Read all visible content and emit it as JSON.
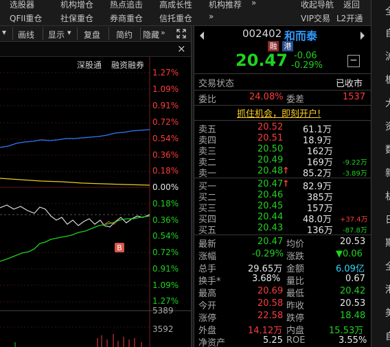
{
  "top_menu": {
    "row1": [
      "选股器",
      "机构增仓",
      "热点追击",
      "高成长性",
      "机构推荐",
      "收起导航",
      "返回"
    ],
    "row2": [
      "QFII重仓",
      "社保重仓",
      "券商重仓",
      "信托重仓",
      "VIP交易",
      "L2开通"
    ],
    "more": "»"
  },
  "right_strip": [
    "全",
    "自",
    "沪",
    "板",
    "大",
    "资",
    "数",
    "新",
    "机",
    "日",
    "期",
    "全",
    "港",
    "美",
    "自"
  ],
  "chart_toolbar": {
    "items": [
      "画线",
      "显示",
      "复盘",
      "简约",
      "隐藏"
    ],
    "dropdown": "▾",
    "close": "×",
    "legend": [
      "深股通",
      "融资融券"
    ]
  },
  "axis_labels": {
    "top": [
      "1.27%",
      "1.09%",
      "0.91%",
      "0.72%",
      "0.54%",
      "0.36%",
      "0.18%",
      "0.00%",
      "0.18%",
      "0.36%",
      "0.54%",
      "0.72%",
      "0.91%",
      "1.09%",
      "1.27%"
    ],
    "volume": [
      "5389",
      "3592"
    ],
    "marker": "B"
  },
  "quote": {
    "code": "002402",
    "name": "和而泰",
    "badge1": "融",
    "badge2": "港",
    "price": "20.47",
    "change": "-0.06",
    "change_pct": "-0.29%",
    "minus_btn": "−",
    "status_label": "交易状态",
    "status_value": "已收市",
    "weibi_label": "委比",
    "weibi_value": "24.08%",
    "weicha_label": "委差",
    "weicha_value": "1537",
    "promo": "抓住机会，即刻开户!",
    "asks": [
      {
        "label": "卖五",
        "price": "20.52",
        "vol": "61.1万",
        "chg": "",
        "arrow": ""
      },
      {
        "label": "卖四",
        "price": "20.51",
        "vol": "18.9万",
        "chg": "",
        "arrow": ""
      },
      {
        "label": "卖三",
        "price": "20.50",
        "vol": "162万",
        "chg": "",
        "arrow": ""
      },
      {
        "label": "卖二",
        "price": "20.49",
        "vol": "169万",
        "chg": "-9.22万",
        "arrow": ""
      },
      {
        "label": "卖一",
        "price": "20.48",
        "vol": "85.2万",
        "chg": "-3.89万",
        "arrow": "↑"
      }
    ],
    "bids": [
      {
        "label": "买一",
        "price": "20.47",
        "vol": "82.9万",
        "chg": "",
        "arrow": "↑"
      },
      {
        "label": "买二",
        "price": "20.46",
        "vol": "385万",
        "chg": "",
        "arrow": ""
      },
      {
        "label": "买三",
        "price": "20.45",
        "vol": "157万",
        "chg": "",
        "arrow": ""
      },
      {
        "label": "买四",
        "price": "20.44",
        "vol": "48.0万",
        "chg": "+37.4万",
        "arrow": ""
      },
      {
        "label": "买五",
        "price": "20.43",
        "vol": "136万",
        "chg": "-87.8万",
        "arrow": ""
      }
    ],
    "stats": [
      {
        "l1": "最新",
        "v1": "20.47",
        "l2": "均价",
        "v2": "20.53"
      },
      {
        "l1": "涨幅",
        "v1": "-0.29%",
        "l2": "涨跌",
        "v2": "▼0.06"
      },
      {
        "l1": "总手",
        "v1": "29.65万",
        "l2": "金额",
        "v2": "6.09亿"
      },
      {
        "l1": "换手*",
        "v1": "3.68%",
        "l2": "量比",
        "v2": "0.67"
      },
      {
        "l1": "最高",
        "v1": "20.69",
        "l2": "最低",
        "v2": "20.42"
      },
      {
        "l1": "今开",
        "v1": "20.58",
        "l2": "昨收",
        "v2": "20.53"
      },
      {
        "l1": "涨停",
        "v1": "22.58",
        "l2": "跌停",
        "v2": "18.48"
      },
      {
        "l1": "外盘",
        "v1": "14.12万",
        "l2": "内盘",
        "v2": "15.53万"
      },
      {
        "l1": "净资产",
        "v1": "5.25",
        "l2": "ROE",
        "v2": "3.55%"
      }
    ]
  },
  "colors": {
    "up": "#ff3b3b",
    "down": "#1fd31f",
    "price_line": "#2f7cff",
    "avg_line": "#e6d21a"
  }
}
